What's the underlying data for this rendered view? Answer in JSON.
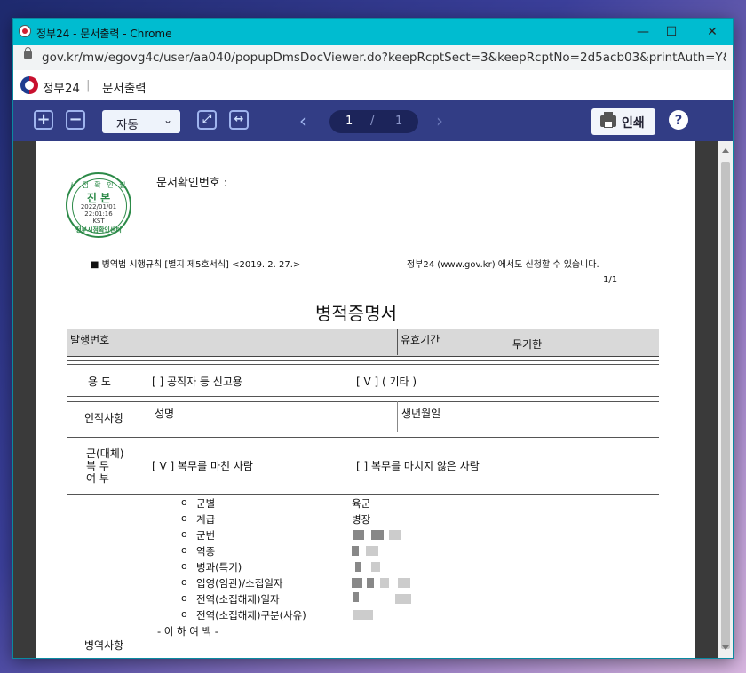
{
  "window": {
    "title": "정부24 - 문서출력 - Chrome",
    "controls": {
      "minimize": "—",
      "maximize": "☐",
      "close": "✕"
    }
  },
  "address_bar": {
    "url": "gov.kr/mw/egovg4c/user/aa040/popupDmsDocViewer.do?keepRcptSect=3&keepRcptNo=2d5acb03&printAuth=Y&web..."
  },
  "site_header": {
    "site_name": "정부24",
    "separator": "|",
    "page_title": "문서출력"
  },
  "toolbar": {
    "zoom_in": "+",
    "zoom_out": "−",
    "zoom_value": "자동",
    "zoom_caret": "⌄",
    "fit_page_icon": "⤢",
    "fit_width_icon": "↔",
    "prev": "‹",
    "next": "›",
    "current_page": "1",
    "page_sep": "/",
    "total_pages": "1",
    "print_label": "인쇄",
    "help": "?"
  },
  "document": {
    "stamp": {
      "top": "시 점 확 인 필",
      "main": "진 본",
      "date": "2022/01/01",
      "time": "22:01:16",
      "tz": "KST",
      "bottom": "정부시점확인센터"
    },
    "confirm_no_label": "문서확인번호 :",
    "law_ref": "■ 병역법 시행규칙 [별지 제5호서식] <2019. 2. 27.>",
    "apply_note": "정부24 (www.gov.kr) 에서도 신청할 수 있습니다.",
    "page_count": "1/1",
    "title": "병적증명서",
    "issue_no_label": "발행번호",
    "validity_label": "유효기간",
    "validity_value": "무기한",
    "purpose_label": "용  도",
    "purpose_opt1": "[    ] 공직자 등 신고용",
    "purpose_opt2": "[  V  ] ( 기타 )",
    "person_label": "인적사항",
    "name_label": "성명",
    "birth_label": "생년월일",
    "service_label_1": "군(대체)",
    "service_label_2": "복    무",
    "service_label_3": "여    부",
    "service_opt1": "[  V  ] 복무를 마친 사람",
    "service_opt2": "[    ] 복무를 마치지 않은 사람",
    "record_label": "병역사항",
    "record_items": [
      {
        "bullet": "o",
        "label": "군별",
        "value": "육군"
      },
      {
        "bullet": "o",
        "label": "계급",
        "value": "병장"
      },
      {
        "bullet": "o",
        "label": "군번",
        "value": ""
      },
      {
        "bullet": "o",
        "label": "역종",
        "value": ""
      },
      {
        "bullet": "o",
        "label": "병과(특기)",
        "value": ""
      },
      {
        "bullet": "o",
        "label": "입영(임관)/소집일자",
        "value": ""
      },
      {
        "bullet": "o",
        "label": "전역(소집해제)일자",
        "value": ""
      },
      {
        "bullet": "o",
        "label": "전역(소집해제)구분(사유)",
        "value": ""
      }
    ],
    "end_mark": "- 이 하 여 백 -"
  }
}
